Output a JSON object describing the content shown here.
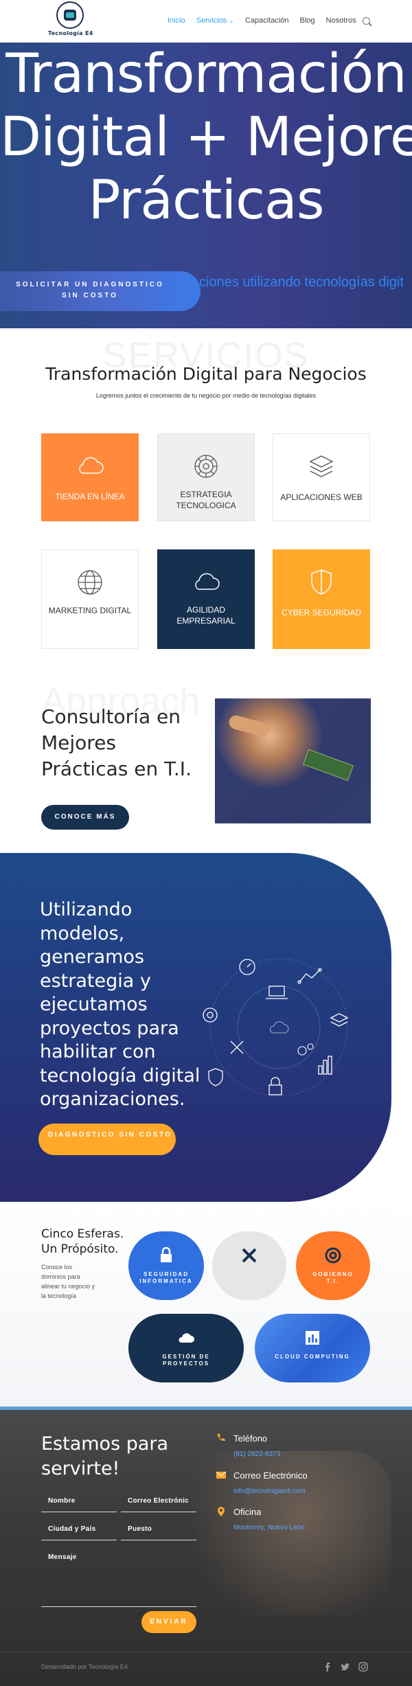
{
  "header": {
    "logo_text": "Tecnología E4",
    "nav": [
      "Inicio",
      "Servicios",
      "Capacitación",
      "Blog",
      "Nosotros"
    ],
    "nav_dropdown_marker": "⌄"
  },
  "hero": {
    "title_lines": [
      "Transformación",
      "Digital + Mejores",
      "Prácticas"
    ],
    "ticker": "ciones utilizando tecnologías digit",
    "cta": "SOLICITAR UN DIAGNOSTICO SIN COSTO"
  },
  "services": {
    "ghost": "SERVICIOS",
    "title": "Transformación Digital para Negocios",
    "subtitle": "Logremos juntos el crecimiento de tu negocio por medio de tecnologías digitales",
    "cards": [
      {
        "label": "TIENDA EN LÍNEA",
        "icon": "cloud-icon"
      },
      {
        "label": "ESTRATEGIA TECNOLOGICA",
        "icon": "gear-icon"
      },
      {
        "label": "APLICACIONES WEB",
        "icon": "layers-icon"
      },
      {
        "label": "MARKETING DIGITAL",
        "icon": "globe-icon"
      },
      {
        "label": "AGILIDAD EMPRESARIAL",
        "icon": "cloud-icon"
      },
      {
        "label": "CYBER SEGURIDAD",
        "icon": "shield-icon"
      }
    ]
  },
  "consulting": {
    "ghost": "Approach",
    "title": "Consultoría en Mejores Prácticas en T.I.",
    "button": "CONOCE MÁS"
  },
  "method": {
    "text": "Utilizando modelos, generamos estrategia y ejecutamos proyectos para habilitar con tecnología digital organizaciones.",
    "button": "DIAGNOSTICO SIN COSTO"
  },
  "spheres": {
    "title_line1": "Cinco Esferas.",
    "title_line2": "Un Própósito.",
    "text": "Conoce los dominios para alinear tu negocio y la tecnología",
    "items": [
      {
        "label": "SEGURIDAD INFORMATICA",
        "icon": "lock-icon",
        "color": "#2f6fe0"
      },
      {
        "label": "GESTIÓN SERVICIOS T.I",
        "icon": "tools-icon",
        "color": "#e6e6e6"
      },
      {
        "label": "GOBIERNO T.I.",
        "icon": "lifebuoy-icon",
        "color": "#ff7a2a"
      },
      {
        "label": "GESTIÓN DE PROYECTOS",
        "icon": "cloud-icon",
        "color": "#16304f"
      },
      {
        "label": "CLOUD COMPUTING",
        "icon": "chart-icon",
        "color": "#3f78e0"
      }
    ]
  },
  "contact": {
    "title": "Estamos para servirte!",
    "fields": {
      "name": "Nombre",
      "email": "Correo Electrónic",
      "city": "Ciudad y País",
      "position": "Puesto",
      "message": "Mensaje"
    },
    "send": "ENVIAR",
    "phone_label": "Teléfono",
    "phone_value": "(81) 2622-8373",
    "email_label": "Correo Electrónico",
    "email_value": "info@tecnologiae4.com",
    "office_label": "Oficina",
    "office_value": "Monterrey, Nuevo León"
  },
  "footer": {
    "text": "Desarrollado por Tecnología E4"
  },
  "colors": {
    "accent": "#2ea3f2",
    "orange": "#ff8a3c",
    "navy": "#16304f",
    "yellow": "#ffa82a"
  }
}
